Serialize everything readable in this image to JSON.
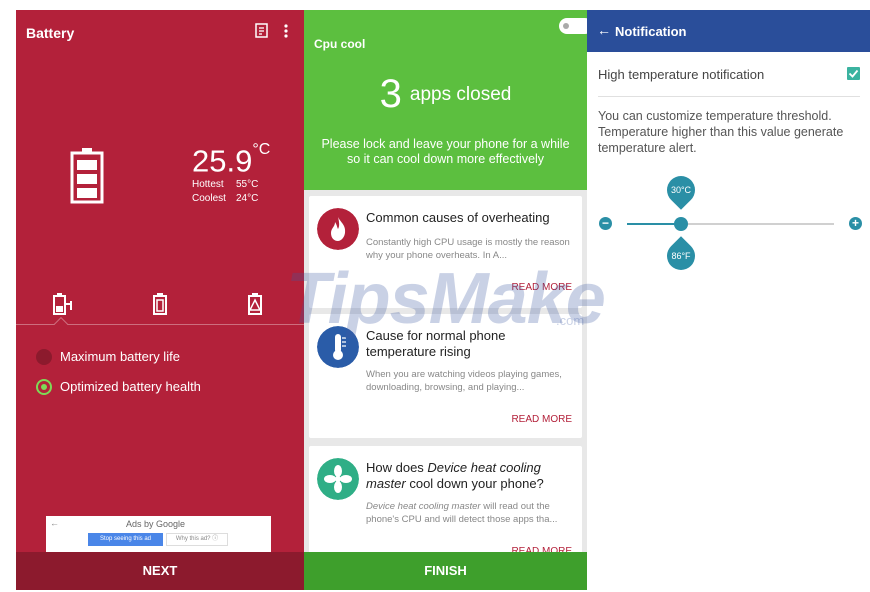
{
  "battery": {
    "title": "Battery",
    "temperature": "25.9",
    "unit": "°C",
    "hottest_label": "Hottest",
    "hottest_value": "55°C",
    "coolest_label": "Coolest",
    "coolest_value": "24°C",
    "options": [
      {
        "label": "Maximum battery life",
        "selected": false
      },
      {
        "label": "Optimized battery health",
        "selected": true
      }
    ],
    "ad": {
      "ads_by": "Ads by Google",
      "stop_label": "Stop seeing this ad",
      "why_label": "Why this ad? ⓘ"
    },
    "next_label": "NEXT",
    "accent_color": "#b3213a"
  },
  "cpu": {
    "title": "Cpu cool",
    "apps_count": "3",
    "apps_closed_text": "apps closed",
    "description": "Please lock and leave your phone for a while so it can cool down more effectively",
    "cards": [
      {
        "title": "Common causes of overheating",
        "text": "Constantly high CPU usage is mostly the reason why your phone overheats. In A...",
        "read_more": "READ MORE",
        "icon": "flame-icon",
        "icon_color": "#b3213a"
      },
      {
        "title": "Cause for normal phone temperature rising",
        "text": "When you are watching videos playing games, downloading, browsing, and playing...",
        "read_more": "READ MORE",
        "icon": "thermometer-icon",
        "icon_color": "#2a5ca8"
      },
      {
        "title_pre": "How does ",
        "title_em": "Device heat cooling master",
        "title_post": " cool down your phone?",
        "text_em": "Device heat cooling master",
        "text_post": " will read out the phone's CPU and will detect those apps tha...",
        "read_more": "READ MORE",
        "icon": "fan-icon",
        "icon_color": "#2fae86"
      }
    ],
    "finish_label": "FINISH",
    "accent_color": "#5cbf3f"
  },
  "notification": {
    "title": "Notification",
    "setting_label": "High temperature notification",
    "checked": true,
    "description": "You can customize temperature threshold. Temperature higher than this value generate temperature alert.",
    "threshold_c": "30°C",
    "threshold_f": "86°F",
    "accent_color": "#2a4e9a"
  },
  "watermark": {
    "text": "TipsMake",
    "suffix": ".com"
  }
}
